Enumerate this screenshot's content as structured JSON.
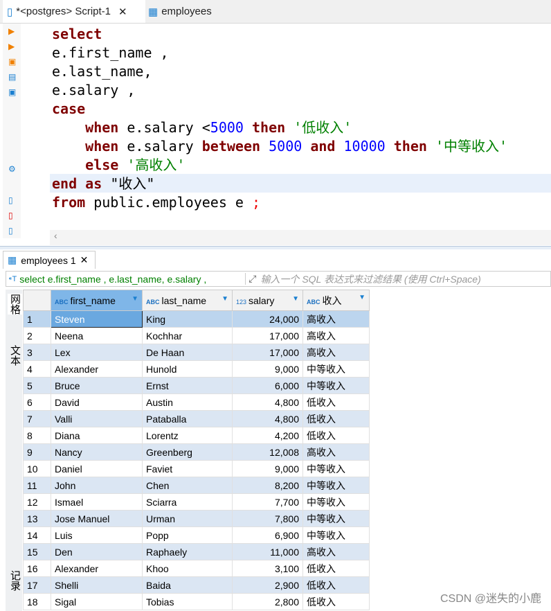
{
  "tabs": [
    {
      "label": "*<postgres> Script-1",
      "active": true
    },
    {
      "label": "employees"
    }
  ],
  "editor": {
    "lines": [
      "select",
      "e.first_name ,",
      "e.last_name,",
      "e.salary ,",
      "case"
    ],
    "when1": {
      "kw1": "when",
      "expr": " e.salary <",
      "num": "5000",
      "kw2": "then",
      "str": "'低收入'"
    },
    "when2": {
      "kw1": "when",
      "expr": " e.salary ",
      "kw2": "between",
      "n1": "5000",
      "kw3": "and",
      "n2": "10000",
      "kw4": "then",
      "str": "'中等收入'"
    },
    "else": {
      "kw": "else",
      "str": "'高收入'"
    },
    "end": {
      "kw1": "end",
      "kw2": "as",
      "alias": "\"收入\""
    },
    "from": {
      "kw": "from",
      "rest": " public.employees e ",
      "semi": ";"
    }
  },
  "results": {
    "tab_label": "employees 1",
    "filter_sql": "select e.first_name , e.last_name, e.salary ,",
    "filter_placeholder": "输入一个 SQL 表达式来过滤结果 (使用 Ctrl+Space)",
    "side_tabs": [
      "网格",
      "文本",
      "记录"
    ],
    "columns": [
      {
        "type": "ABC",
        "name": "first_name"
      },
      {
        "type": "ABC",
        "name": "last_name"
      },
      {
        "type": "123",
        "name": "salary"
      },
      {
        "type": "ABC",
        "name": "收入"
      }
    ],
    "rows": [
      [
        "1",
        "Steven",
        "King",
        "24,000",
        "高收入"
      ],
      [
        "2",
        "Neena",
        "Kochhar",
        "17,000",
        "高收入"
      ],
      [
        "3",
        "Lex",
        "De Haan",
        "17,000",
        "高收入"
      ],
      [
        "4",
        "Alexander",
        "Hunold",
        "9,000",
        "中等收入"
      ],
      [
        "5",
        "Bruce",
        "Ernst",
        "6,000",
        "中等收入"
      ],
      [
        "6",
        "David",
        "Austin",
        "4,800",
        "低收入"
      ],
      [
        "7",
        "Valli",
        "Pataballa",
        "4,800",
        "低收入"
      ],
      [
        "8",
        "Diana",
        "Lorentz",
        "4,200",
        "低收入"
      ],
      [
        "9",
        "Nancy",
        "Greenberg",
        "12,008",
        "高收入"
      ],
      [
        "10",
        "Daniel",
        "Faviet",
        "9,000",
        "中等收入"
      ],
      [
        "11",
        "John",
        "Chen",
        "8,200",
        "中等收入"
      ],
      [
        "12",
        "Ismael",
        "Sciarra",
        "7,700",
        "中等收入"
      ],
      [
        "13",
        "Jose Manuel",
        "Urman",
        "7,800",
        "中等收入"
      ],
      [
        "14",
        "Luis",
        "Popp",
        "6,900",
        "中等收入"
      ],
      [
        "15",
        "Den",
        "Raphaely",
        "11,000",
        "高收入"
      ],
      [
        "16",
        "Alexander",
        "Khoo",
        "3,100",
        "低收入"
      ],
      [
        "17",
        "Shelli",
        "Baida",
        "2,900",
        "低收入"
      ],
      [
        "18",
        "Sigal",
        "Tobias",
        "2,800",
        "低收入"
      ]
    ]
  },
  "watermark": "CSDN @迷失的小鹿"
}
